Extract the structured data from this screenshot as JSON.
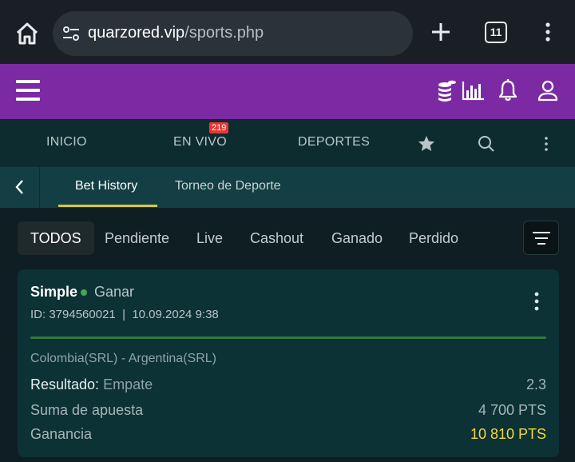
{
  "browser": {
    "url_domain": "quarzored.vip",
    "url_path": "/sports.php",
    "tab_count": "11"
  },
  "nav": {
    "items": [
      {
        "label": "INICIO"
      },
      {
        "label": "EN VIVO",
        "badge": "219"
      },
      {
        "label": "DEPORTES"
      }
    ]
  },
  "subnav": {
    "tabs": [
      {
        "label": "Bet History",
        "active": true
      },
      {
        "label": "Torneo de Deporte",
        "active": false
      }
    ]
  },
  "filters": [
    {
      "label": "TODOS",
      "active": true
    },
    {
      "label": "Pendiente"
    },
    {
      "label": "Live"
    },
    {
      "label": "Cashout"
    },
    {
      "label": "Ganado"
    },
    {
      "label": "Perdido"
    }
  ],
  "bet": {
    "type": "Simple",
    "status": "Ganar",
    "meta": "ID: 3794560021  |  10.09.2024 9:38",
    "match": "Colombia(SRL) - Argentina(SRL)",
    "result_label": "Resultado:",
    "result_value": "Empate",
    "odds": "2.3",
    "stake_label": "Suma de apuesta",
    "stake_value": "4 700 PTS",
    "gain_label": "Ganancia",
    "gain_value": "10 810 PTS"
  },
  "colors": {
    "header": "#7b2aa3",
    "accent": "#d7c64a",
    "won": "#43a74e",
    "gain": "#f4d73a"
  }
}
